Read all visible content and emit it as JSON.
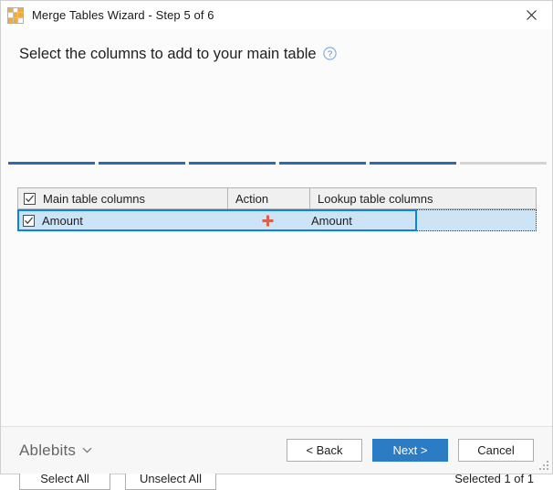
{
  "window": {
    "title": "Merge Tables Wizard - Step 5 of 6",
    "app_icon": "merge-tables-grid-icon",
    "close_icon": "close-icon"
  },
  "header": {
    "title": "Select the columns to add to your main table",
    "help_icon": "help-circle-icon"
  },
  "steps": {
    "total": 6,
    "completed": 5,
    "accent_color": "#2b6cb0",
    "inactive_color": "#d4d4d4"
  },
  "grid": {
    "columns": [
      {
        "label": "Main table columns",
        "has_checkbox": true
      },
      {
        "label": "Action",
        "has_checkbox": false
      },
      {
        "label": "Lookup table columns",
        "has_checkbox": false
      }
    ],
    "header_checkbox_checked": true,
    "rows": [
      {
        "checked": true,
        "main_column": "Amount",
        "action_icon": "plus-icon",
        "action_color": "#d9604a",
        "lookup_column": "Amount",
        "selected": true
      }
    ]
  },
  "selection_bar": {
    "select_all_label": "Select All",
    "unselect_all_label": "Unselect All",
    "selected_count_text": "Selected 1 of 1"
  },
  "footer": {
    "brand": "Ablebits",
    "brand_caret_icon": "chevron-down-icon",
    "back_label": "< Back",
    "next_label": "Next >",
    "cancel_label": "Cancel",
    "primary_color": "#2b7cc4",
    "resize_grip_icon": "resize-grip-icon"
  }
}
